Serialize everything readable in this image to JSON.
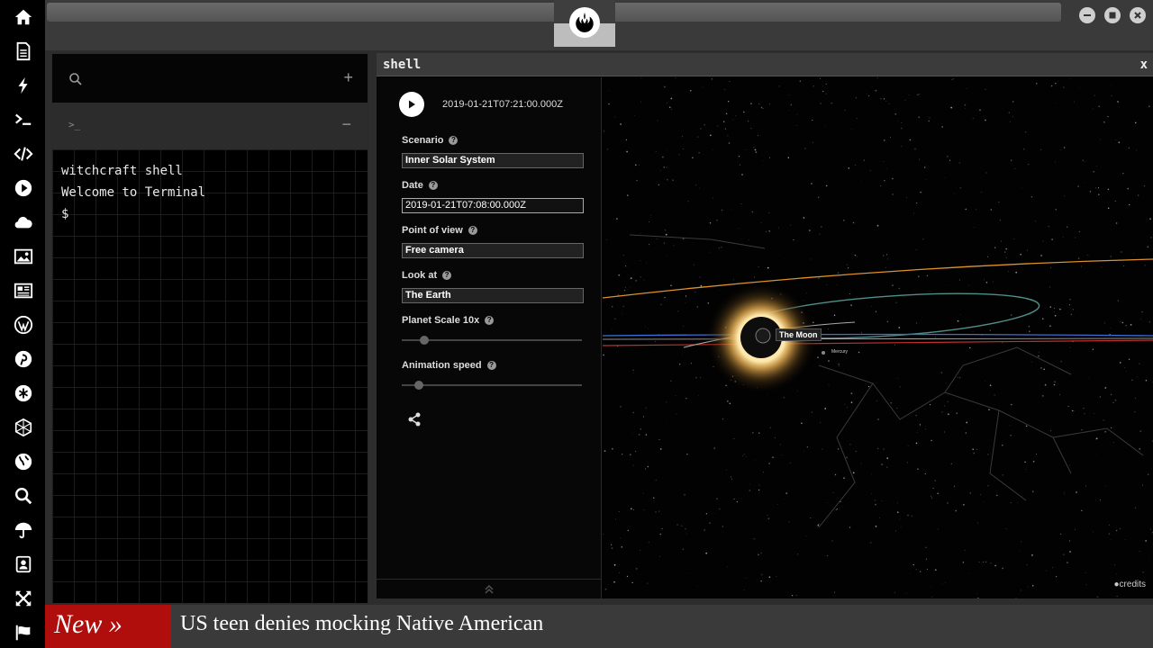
{
  "sidebar": {
    "icons": [
      "home-icon",
      "document-icon",
      "lightning-icon",
      "terminal-icon",
      "code-icon",
      "play-icon",
      "cloud-icon",
      "image-icon",
      "newspaper-icon",
      "wordpress-icon",
      "pinterest-icon",
      "asterisk-icon",
      "globe-mesh-icon",
      "globe-icon",
      "search-icon",
      "umbrella-icon",
      "contacts-icon",
      "expand-icon",
      "flag-icon"
    ]
  },
  "terminal": {
    "tab_prompt": ">_",
    "output": [
      "witchcraft shell",
      "Welcome to Terminal",
      "$"
    ]
  },
  "shell": {
    "title": "shell",
    "close": "x",
    "current_date": "2019-01-21T07:21:00.000Z",
    "fields": {
      "scenario_label": "Scenario",
      "scenario_value": "Inner Solar System",
      "date_label": "Date",
      "date_value": "2019-01-21T07:08:00.000Z",
      "pov_label": "Point of view",
      "pov_value": "Free camera",
      "lookat_label": "Look at",
      "lookat_value": "The Earth",
      "scale_label": "Planet Scale 10x",
      "speed_label": "Animation speed"
    },
    "moon_label": "The Moon",
    "mercury_label": "Mercury",
    "credits": "credits"
  },
  "ticker": {
    "badge": "New »",
    "headline": "US teen denies mocking Native American"
  },
  "colors": {
    "ticker_red": "#b00d0d",
    "orbit_orange": "#e0922a",
    "orbit_teal": "#4f8f8a",
    "orbit_blue": "#3f6fd0",
    "orbit_red": "#c0302a"
  }
}
